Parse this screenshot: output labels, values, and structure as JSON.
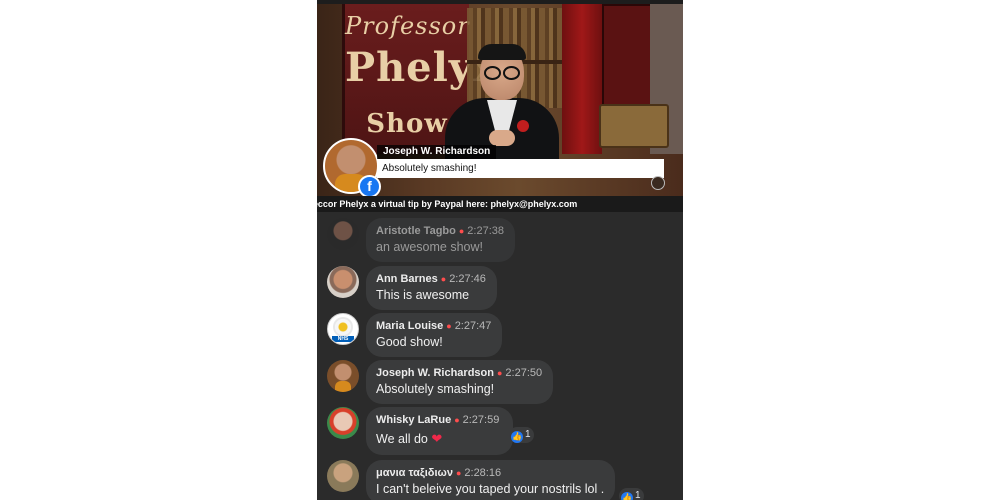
{
  "video": {
    "poster_line1": "Professor",
    "poster_line2": "Phelyx",
    "poster_line3": "Show",
    "overlay": {
      "name": "Joseph W. Richardson",
      "comment": "Absolutely smashing!",
      "platform_icon": "facebook-icon"
    },
    "ticker": "ессоr Phelyx a virtual tip by Paypal here: phelyx@phelyx.com"
  },
  "comments": [
    {
      "name": "Aristotle Tagbo",
      "time": "2:27:38",
      "text": "an awesome show!"
    },
    {
      "name": "Ann Barnes",
      "time": "2:27:46",
      "text": "This is awesome"
    },
    {
      "name": "Maria Louise",
      "time": "2:27:47",
      "text": "Good show!",
      "avatar_badge": "NHS"
    },
    {
      "name": "Joseph W. Richardson",
      "time": "2:27:50",
      "text": "Absolutely smashing!"
    },
    {
      "name": "Whisky LaRue",
      "time": "2:27:59",
      "text": "We all do",
      "emoji": "❤",
      "reaction_count": "1",
      "reaction_icon": "like-icon"
    },
    {
      "name": "μανια ταξιδιων",
      "time": "2:28:16",
      "text": "I can't beleive you taped your nostrils lol .",
      "reaction_count": "1",
      "reaction_icon": "like-icon"
    }
  ],
  "colors": {
    "background": "#2b2b2b",
    "bubble": "#3a3b3c",
    "live_dot": "#ff4d4d",
    "facebook_blue": "#1877f2",
    "like_blue": "#2078f4",
    "heart": "#f0284a"
  }
}
